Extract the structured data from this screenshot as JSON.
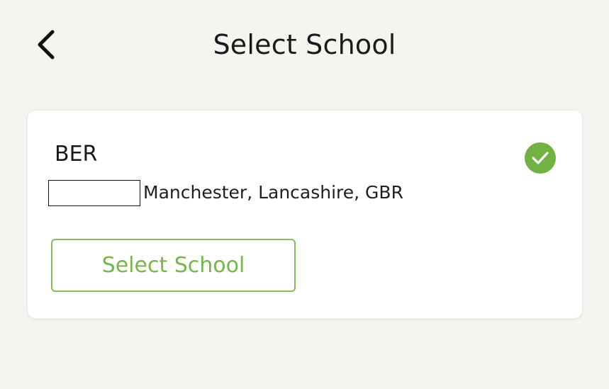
{
  "header": {
    "back_icon": "chevron-left-icon",
    "title": "Select School"
  },
  "school": {
    "name": "BER",
    "address_redacted": true,
    "address": "Manchester, Lancashire, GBR",
    "selected_icon": "check-circle-icon",
    "select_button_label": "Select School"
  },
  "colors": {
    "background": "#f4f4f0",
    "card": "#ffffff",
    "accent_green": "#72b243",
    "button_border": "#84bd57",
    "button_text": "#79b44c"
  }
}
